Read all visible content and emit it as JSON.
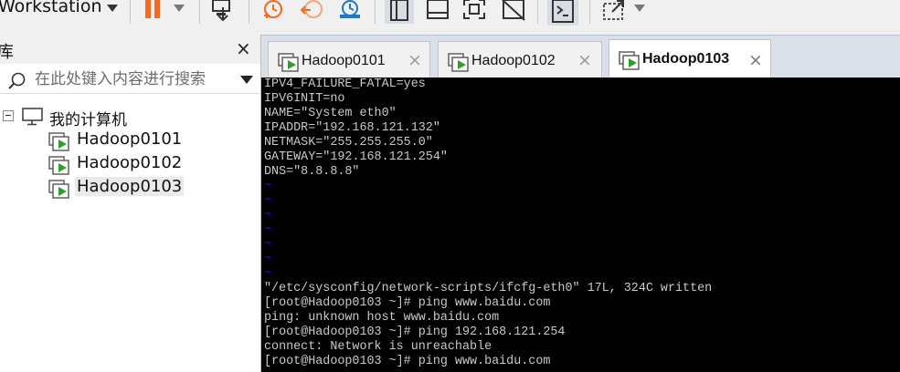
{
  "toolbar": {
    "app_title": "Workstation",
    "icons": [
      "app-menu-caret",
      "pause-icon",
      "power-dropdown-caret",
      "send-ctrl-alt-del-icon",
      "take-snapshot-icon",
      "revert-snapshot-icon",
      "snapshot-manager-icon",
      "show-library-icon",
      "thumbnail-bar-icon",
      "full-screen-icon",
      "unity-icon",
      "console-view-icon",
      "stretch-guest-icon",
      "stretch-dropdown-caret"
    ]
  },
  "library": {
    "title": "库",
    "close_glyph": "×",
    "search_placeholder": "在此处键入内容进行搜索",
    "root_label": "我的计算机",
    "vms": [
      {
        "label": "Hadoop0101",
        "selected": false
      },
      {
        "label": "Hadoop0102",
        "selected": false
      },
      {
        "label": "Hadoop0103",
        "selected": true
      }
    ]
  },
  "tabs": [
    {
      "label": "Hadoop0101",
      "active": false,
      "close": "×"
    },
    {
      "label": "Hadoop0102",
      "active": false,
      "close": "×"
    },
    {
      "label": "Hadoop0103",
      "active": true,
      "close": "×"
    }
  ],
  "console": {
    "config_lines": [
      "IPV4_FAILURE_FATAL=yes",
      "IPV6INIT=no",
      "NAME=\"System eth0\"",
      "IPADDR=\"192.168.121.132\"",
      "NETMASK=\"255.255.255.0\"",
      "GATEWAY=\"192.168.121.254\"",
      "DNS=\"8.8.8.8\""
    ],
    "empty_line_marker": "~",
    "empty_line_count": 7,
    "output_lines": [
      "\"/etc/sysconfig/network-scripts/ifcfg-eth0\" 17L, 324C written",
      "[root@Hadoop0103 ~]# ping www.baidu.com",
      "ping: unknown host www.baidu.com",
      "[root@Hadoop0103 ~]# ping 192.168.121.254",
      "connect: Network is unreachable",
      "[root@Hadoop0103 ~]# ping www.baidu.com"
    ],
    "colors": {
      "background": "#000000",
      "text": "#c8c8c8",
      "tilde": "#1818c8"
    }
  },
  "colors": {
    "accent_orange": "#f26b21",
    "vm_green": "#2e9e2e",
    "snapshot_blue": "#1f77c8"
  }
}
